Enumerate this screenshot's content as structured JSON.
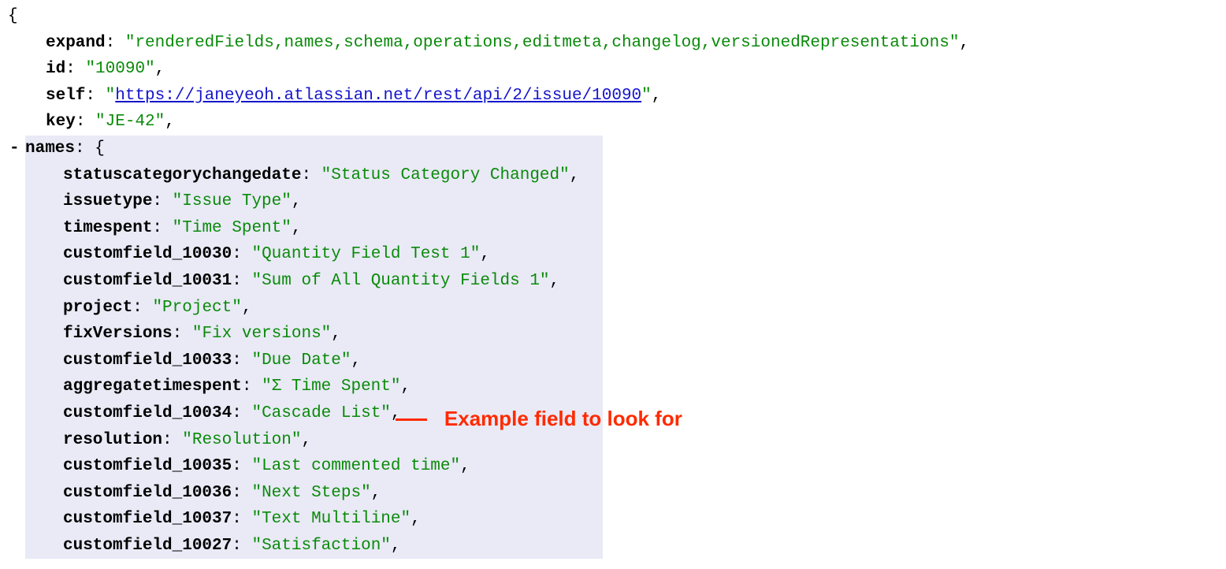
{
  "root": {
    "expand_key": "expand",
    "expand_val": "renderedFields,names,schema,operations,editmeta,changelog,versionedRepresentations",
    "id_key": "id",
    "id_val": "10090",
    "self_key": "self",
    "self_val": "https://janeyeoh.atlassian.net/rest/api/2/issue/10090",
    "key_key": "key",
    "key_val": "JE-42",
    "names_key": "names"
  },
  "toggle": "-",
  "names": [
    {
      "k": "statuscategorychangedate",
      "v": "Status Category Changed"
    },
    {
      "k": "issuetype",
      "v": "Issue Type"
    },
    {
      "k": "timespent",
      "v": "Time Spent"
    },
    {
      "k": "customfield_10030",
      "v": "Quantity Field Test 1"
    },
    {
      "k": "customfield_10031",
      "v": "Sum of All Quantity Fields 1"
    },
    {
      "k": "project",
      "v": "Project"
    },
    {
      "k": "fixVersions",
      "v": "Fix versions"
    },
    {
      "k": "customfield_10033",
      "v": "Due Date"
    },
    {
      "k": "aggregatetimespent",
      "v": "Σ Time Spent"
    },
    {
      "k": "customfield_10034",
      "v": "Cascade List"
    },
    {
      "k": "resolution",
      "v": "Resolution"
    },
    {
      "k": "customfield_10035",
      "v": "Last commented time"
    },
    {
      "k": "customfield_10036",
      "v": "Next Steps"
    },
    {
      "k": "customfield_10037",
      "v": "Text Multiline"
    },
    {
      "k": "customfield_10027",
      "v": "Satisfaction"
    }
  ],
  "callout": {
    "text": "Example field to look for",
    "target_index": 9
  }
}
